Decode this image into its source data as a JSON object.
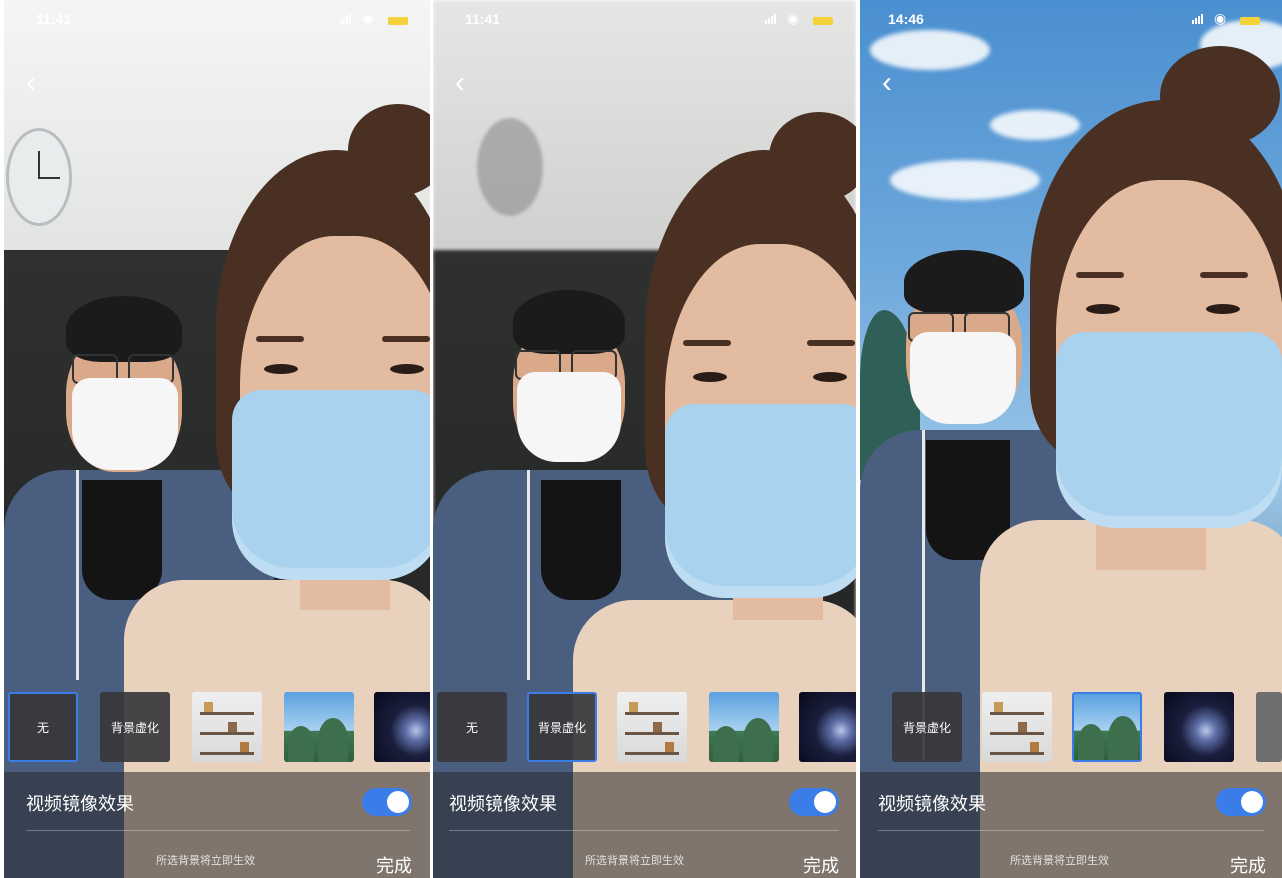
{
  "panels": [
    {
      "status_time": "11:41",
      "back_icon": "chevron-left-icon",
      "thumbnails": [
        {
          "kind": "label",
          "label": "无",
          "selected": true
        },
        {
          "kind": "label",
          "label": "背景虚化",
          "selected": false
        },
        {
          "kind": "image",
          "image": "room-background",
          "selected": false
        },
        {
          "kind": "image",
          "image": "mountain-background",
          "selected": false
        },
        {
          "kind": "image",
          "image": "space-background",
          "selected": false
        }
      ],
      "mirror_label": "视频镜像效果",
      "mirror_on": true,
      "hint": "所选背景将立即生效",
      "done_label": "完成"
    },
    {
      "status_time": "11:41",
      "back_icon": "chevron-left-icon",
      "thumbnails": [
        {
          "kind": "label",
          "label": "无",
          "selected": false
        },
        {
          "kind": "label",
          "label": "背景虚化",
          "selected": true
        },
        {
          "kind": "image",
          "image": "room-background",
          "selected": false
        },
        {
          "kind": "image",
          "image": "mountain-background",
          "selected": false
        },
        {
          "kind": "image",
          "image": "space-background",
          "selected": false
        }
      ],
      "mirror_label": "视频镜像效果",
      "mirror_on": true,
      "hint": "所选背景将立即生效",
      "done_label": "完成"
    },
    {
      "status_time": "14:46",
      "back_icon": "chevron-left-icon",
      "thumbnails": [
        {
          "kind": "label",
          "label": "背景虚化",
          "selected": false
        },
        {
          "kind": "image",
          "image": "room-background",
          "selected": false
        },
        {
          "kind": "image",
          "image": "mountain-background",
          "selected": true
        },
        {
          "kind": "image",
          "image": "space-background",
          "selected": false
        },
        {
          "kind": "image",
          "image": "grey-background",
          "selected": false
        }
      ],
      "mirror_label": "视频镜像效果",
      "mirror_on": true,
      "hint": "所选背景将立即生效",
      "done_label": "完成"
    }
  ],
  "colors": {
    "accent": "#3b7de8",
    "battery": "#f3d23a"
  }
}
